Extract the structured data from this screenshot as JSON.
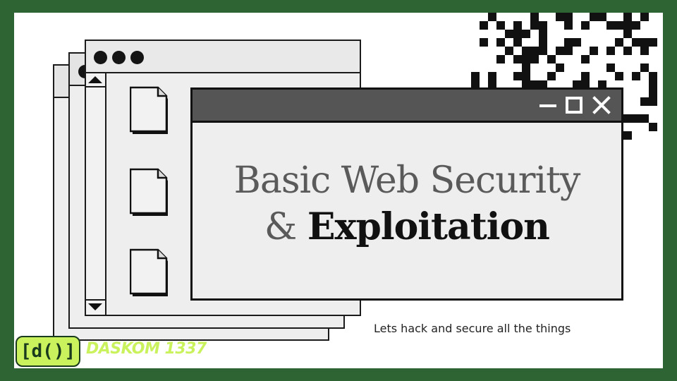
{
  "slide": {
    "title_line1": "Basic Web Security",
    "title_ampersand": "&",
    "title_line2": "Exploitation",
    "subtitle": "Lets hack and secure all the things"
  },
  "window_controls": [
    "minimize-icon",
    "maximize-icon",
    "close-icon"
  ],
  "logo": {
    "icon_text": "[d()]",
    "name": "DASKOM 1337"
  },
  "colors": {
    "frame": "#2e6434",
    "title_bar": "#555555",
    "window_bg": "#eeeeee",
    "heading_gray": "#5a5a5a",
    "heading_dark": "#111111",
    "logo_accent": "#c9f25c"
  }
}
